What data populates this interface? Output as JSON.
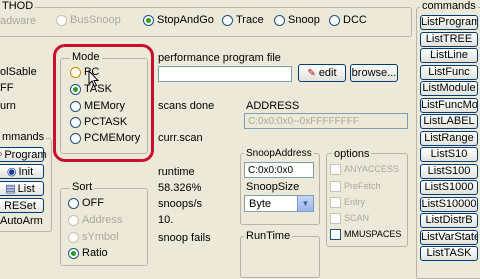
{
  "top": {
    "method_title": "THOD",
    "hardware_label": "adware",
    "options": [
      {
        "label": "BusSnoop",
        "selected": false,
        "enabled": false
      },
      {
        "label": "StopAndGo",
        "selected": true,
        "enabled": true
      },
      {
        "label": "Trace",
        "selected": false,
        "enabled": true
      },
      {
        "label": "Snoop",
        "selected": false,
        "enabled": true
      },
      {
        "label": "DCC",
        "selected": false,
        "enabled": true
      }
    ]
  },
  "left": {
    "labels": [
      "olSable",
      "FF",
      "urn"
    ],
    "commands_title": "mmands",
    "buttons": [
      "Program",
      "Init",
      "List",
      "RESet",
      "AutoArm"
    ]
  },
  "mode": {
    "title": "Mode",
    "options": [
      {
        "label": "PC",
        "selected": false
      },
      {
        "label": "TASK",
        "selected": true
      },
      {
        "label": "MEMory",
        "selected": false
      },
      {
        "label": "PCTASK",
        "selected": false
      },
      {
        "label": "PCMEMory",
        "selected": false
      }
    ]
  },
  "sort": {
    "title": "Sort",
    "options": [
      {
        "label": "OFF",
        "selected": false,
        "enabled": true
      },
      {
        "label": "Address",
        "selected": false,
        "enabled": false
      },
      {
        "label": "sYmbol",
        "selected": false,
        "enabled": false
      },
      {
        "label": "Ratio",
        "selected": true,
        "enabled": true
      }
    ]
  },
  "perf": {
    "file_label": "performance program file",
    "file_value": "",
    "edit_label": "edit",
    "browse_label": "browse..."
  },
  "stats": {
    "scans_done_label": "scans done",
    "curr_scan_label": "curr.scan",
    "runtime_label": "runtime",
    "runtime_value": "58.326%",
    "snoops_label": "snoops/s",
    "snoops_value": "10.",
    "snoop_fails_label": "snoop fails"
  },
  "address": {
    "label": "ADDRESS",
    "value": "C:0x0:0x0--0xFFFFFFFF"
  },
  "snoop": {
    "address_label": "SnoopAddress",
    "address_value": "C:0x0:0x0",
    "size_label": "SnoopSize",
    "size_value": "Byte",
    "runtime_label": "RunTime"
  },
  "options": {
    "title": "options",
    "items": [
      {
        "label": "ANYACCESS",
        "enabled": false
      },
      {
        "label": "PreFetch",
        "enabled": false
      },
      {
        "label": "Entry",
        "enabled": false
      },
      {
        "label": "SCAN",
        "enabled": false
      },
      {
        "label": "MMUSPACES",
        "enabled": true
      }
    ]
  },
  "commands": {
    "title": "commands",
    "buttons": [
      "ListProgram",
      "ListTREE",
      "ListLine",
      "ListFunc",
      "ListModule",
      "ListFuncMod",
      "ListLABEL",
      "ListRange",
      "ListS10",
      "ListS100",
      "ListS1000",
      "ListS10000",
      "ListDistrB",
      "ListVarState",
      "ListTASK"
    ]
  },
  "colors": {
    "highlight": "#c8102e",
    "button_border": "#003c74",
    "radio_dot": "#21a121"
  }
}
